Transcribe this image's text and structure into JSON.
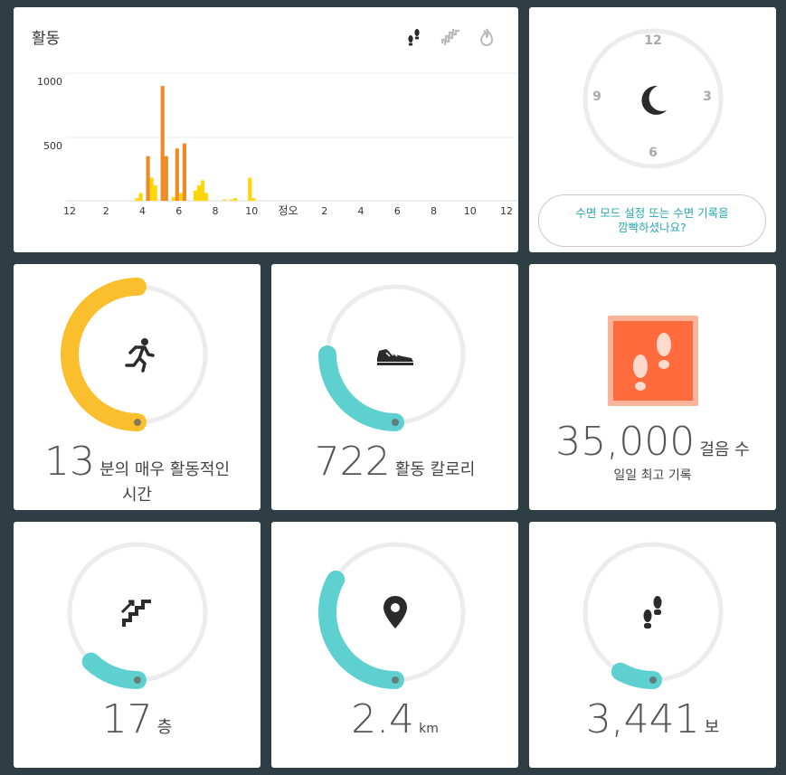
{
  "activity": {
    "title": "활동",
    "icons": [
      "steps-icon",
      "stairs-icon",
      "calories-icon"
    ],
    "chart_data": {
      "type": "bar",
      "title": "",
      "xlabel": "",
      "ylabel": "",
      "yticks": [
        "1000",
        "500"
      ],
      "ylim": [
        0,
        1000
      ],
      "xticks": [
        "12",
        "2",
        "4",
        "6",
        "8",
        "10",
        "정오",
        "2",
        "4",
        "6",
        "8",
        "10",
        "12"
      ],
      "x_unit": "hour_of_day",
      "series": [
        {
          "color": "#ffd60a",
          "points": [
            [
              3.6,
              20
            ],
            [
              3.8,
              60
            ],
            [
              4.4,
              180
            ],
            [
              4.6,
              120
            ],
            [
              5.6,
              30
            ],
            [
              6.0,
              60
            ],
            [
              6.8,
              80
            ],
            [
              7.0,
              120
            ],
            [
              7.2,
              160
            ],
            [
              7.4,
              60
            ],
            [
              8.4,
              10
            ],
            [
              8.8,
              10
            ],
            [
              9.0,
              20
            ],
            [
              9.8,
              180
            ],
            [
              10.0,
              20
            ]
          ]
        },
        {
          "color": "#f08a24",
          "points": [
            [
              4.2,
              350
            ],
            [
              5.0,
              900
            ],
            [
              5.2,
              350
            ],
            [
              5.8,
              410
            ],
            [
              6.2,
              450
            ]
          ]
        }
      ]
    }
  },
  "sleep": {
    "clock_labels": {
      "top": "12",
      "right": "3",
      "bottom": "6",
      "left": "9"
    },
    "icon": "moon-icon",
    "button_text": "수면 모드 설정 또는 수면 기록을\n깜빡하셨나요?"
  },
  "tiles": {
    "active_minutes": {
      "value": "13",
      "label": "분의 매우 활동적인\n시간",
      "progress": 0.5,
      "color": "#fbbf2d",
      "icon": "runner-icon"
    },
    "calories": {
      "value": "722",
      "label": "활동 칼로리",
      "progress": 0.25,
      "color": "#5fd0d0",
      "icon": "shoe-icon"
    },
    "best_steps": {
      "value": "35,000",
      "unit": "걸음 수",
      "sub": "일일 최고 기록",
      "icon": "footprints-badge-icon",
      "color": "#ff6b3d"
    },
    "floors": {
      "value": "17",
      "unit": "층",
      "progress": 0.12,
      "color": "#5fd0d0",
      "icon": "stairs-icon"
    },
    "distance": {
      "value": "2.4",
      "unit": "km",
      "progress": 0.33,
      "color": "#5fd0d0",
      "icon": "location-pin-icon"
    },
    "steps": {
      "value": "3,441",
      "unit": "보",
      "progress": 0.08,
      "color": "#5fd0d0",
      "icon": "footprints-icon"
    }
  }
}
